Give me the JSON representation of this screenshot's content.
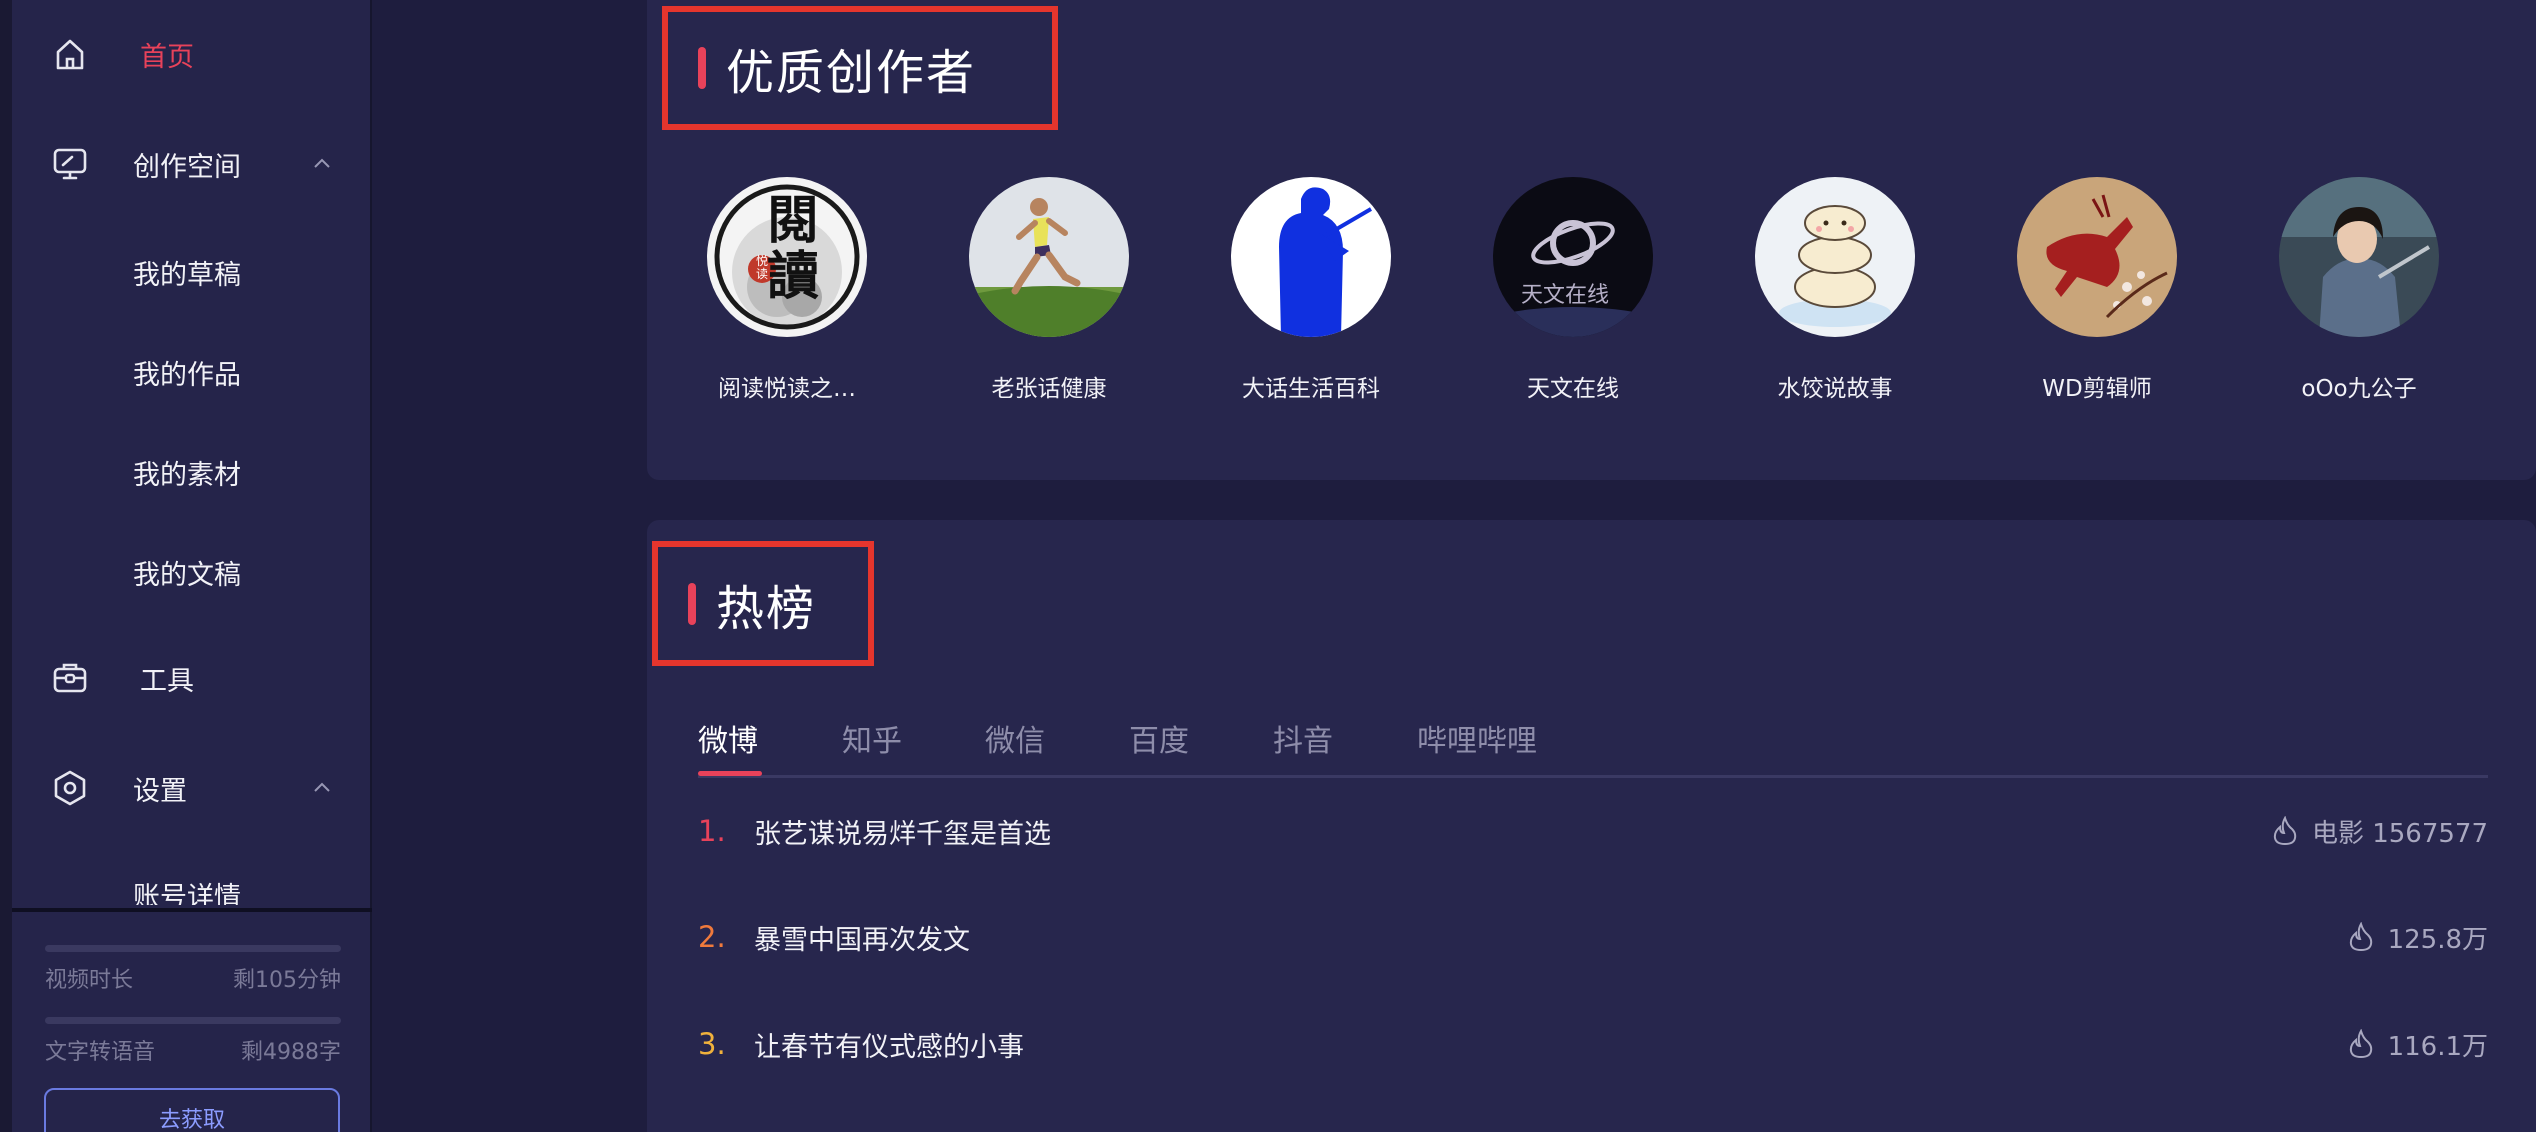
{
  "sidebar": {
    "items": [
      {
        "label": "首页",
        "icon": "home-icon",
        "active": true
      },
      {
        "label": "创作空间",
        "icon": "monitor-pen-icon",
        "expanded": true
      },
      {
        "label": "工具",
        "icon": "toolbox-icon"
      },
      {
        "label": "设置",
        "icon": "gear-hexagon-icon",
        "expanded": true
      }
    ],
    "sub_items": [
      "我的草稿",
      "我的作品",
      "我的素材",
      "我的文稿"
    ],
    "settings_sub_items": [
      "账号详情"
    ],
    "usage": [
      {
        "label": "视频时长",
        "value": "剩105分钟"
      },
      {
        "label": "文字转语音",
        "value": "剩4988字"
      }
    ],
    "get_button": "去获取"
  },
  "creators": {
    "title": "优质创作者",
    "items": [
      {
        "name": "阅读悦读之…",
        "avatar": "calligraphy-reading-avatar",
        "avatar_text": "閱讀",
        "avatar_stamp": "悦读"
      },
      {
        "name": "老张话健康",
        "avatar": "runner-woman-avatar"
      },
      {
        "name": "大话生活百科",
        "avatar": "blue-silhouette-writer-avatar"
      },
      {
        "name": "天文在线",
        "avatar": "planet-astronomy-avatar",
        "avatar_text": "天文在线"
      },
      {
        "name": "水饺说故事",
        "avatar": "dumpling-cartoon-avatar"
      },
      {
        "name": "WD剪辑师",
        "avatar": "red-deer-painting-avatar"
      },
      {
        "name": "oOo九公子",
        "avatar": "portrait-woman-avatar"
      }
    ]
  },
  "hot": {
    "title": "热榜",
    "tabs": [
      "微博",
      "知乎",
      "微信",
      "百度",
      "抖音",
      "哔哩哔哩"
    ],
    "active_tab": "微博",
    "items": [
      {
        "rank": "1.",
        "title": "张艺谋说易烊千玺是首选",
        "heat": "电影 1567577",
        "rank_color": "#e8425a"
      },
      {
        "rank": "2.",
        "title": "暴雪中国再次发文",
        "heat": "125.8万",
        "rank_color": "#f07a3c"
      },
      {
        "rank": "3.",
        "title": "让春节有仪式感的小事",
        "heat": "116.1万",
        "rank_color": "#f0b13c"
      }
    ]
  },
  "colors": {
    "accent": "#e8425a",
    "highlight_box": "#e5352d",
    "background": "#1e1d3e",
    "card": "#27264d"
  }
}
